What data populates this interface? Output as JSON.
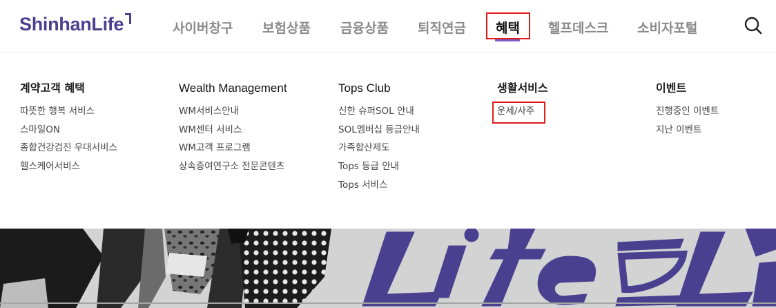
{
  "header": {
    "logo": "ShinhanLife",
    "nav": [
      {
        "label": "사이버창구"
      },
      {
        "label": "보험상품"
      },
      {
        "label": "금융상품"
      },
      {
        "label": "퇴직연금"
      },
      {
        "label": "혜택"
      },
      {
        "label": "헬프데스크"
      },
      {
        "label": "소비자포털"
      }
    ],
    "active_index": 4,
    "search_icon": "search-icon",
    "accent_color": "#4b3f8f",
    "highlight_color": "#e01b1b"
  },
  "mega_menu": {
    "columns": [
      {
        "title": "계약고객 혜택",
        "items": [
          "따뜻한 행복 서비스",
          "스마일ON",
          "종합건강검진 우대서비스",
          "헬스케어서비스"
        ]
      },
      {
        "title": "Wealth Management",
        "items": [
          "WM서비스안내",
          "WM센터 서비스",
          "WM고객 프로그램",
          "상속증여연구소 전문콘텐츠"
        ]
      },
      {
        "title": "Tops Club",
        "items": [
          "신한 슈퍼SOL 안내",
          "SOL멤버십 등급안내",
          "가족합산제도",
          "Tops 등급 안내",
          "Tops 서비스"
        ]
      },
      {
        "title": "생활서비스",
        "items": [
          "운세/사주"
        ]
      },
      {
        "title": "이벤트",
        "items": [
          "진행중인 이벤트",
          "지난 이벤트"
        ]
      }
    ],
    "highlighted_item": "운세/사주"
  },
  "banner": {
    "image": "promo-banner-people-and-life-lettering"
  }
}
